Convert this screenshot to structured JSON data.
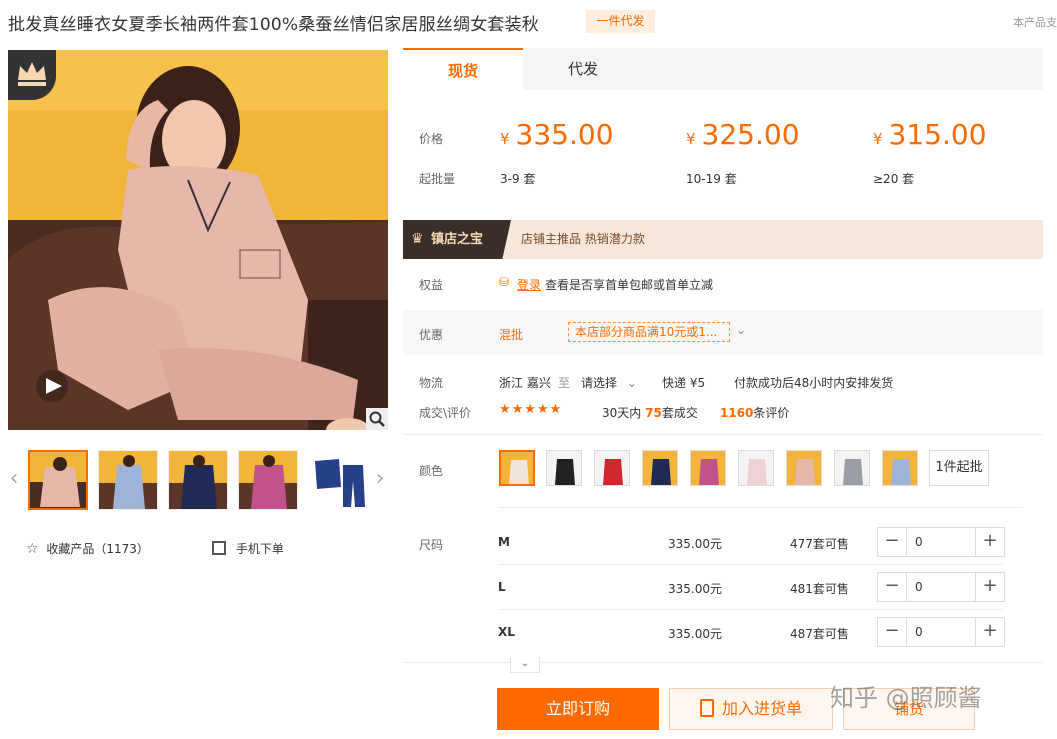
{
  "header": {
    "title": "批发真丝睡衣女夏季长袖两件套100%桑蚕丝情侣家居服丝绸女套装秋",
    "tag": "一件代发",
    "corner_note": "本产品支"
  },
  "gallery": {
    "thumb_count": 6,
    "actions": {
      "favorite_label": "收藏产品（1173）",
      "mobile_label": "手机下单"
    }
  },
  "tabs": [
    {
      "label": "现货",
      "active": true
    },
    {
      "label": "代发",
      "active": false
    }
  ],
  "pricing": {
    "price_label": "价格",
    "moq_label": "起批量",
    "currency": "¥",
    "tiers": [
      {
        "price": "335.00",
        "qty": "3-9",
        "unit": "套"
      },
      {
        "price": "325.00",
        "qty": "10-19",
        "unit": "套"
      },
      {
        "price": "315.00",
        "qty": "≥20",
        "unit": "套"
      }
    ]
  },
  "shop_banner": {
    "tag": "镇店之宝",
    "text": "店铺主推品   热销潜力款"
  },
  "rights": {
    "label": "权益",
    "login": "登录",
    "text": "查看是否享首单包邮或首单立减"
  },
  "promo": {
    "label": "优惠",
    "type": "混批",
    "text": "本店部分商品满10元或1..."
  },
  "shipping": {
    "label": "物流",
    "from": "浙江 嘉兴",
    "to_word": "至",
    "to_select": "请选择",
    "method": "快递 ¥5",
    "note": "付款成功后48小时内安排发货"
  },
  "deals": {
    "label": "成交\\评价",
    "stars": "★★★★★",
    "days_pre": "30天内",
    "count": "75",
    "days_post": "套成交",
    "reviews": "1160",
    "reviews_suffix": "条评价"
  },
  "colors": {
    "label": "颜色",
    "swatch_count": 9,
    "moq_button": "1件起批"
  },
  "sizes": {
    "label": "尺码",
    "rows": [
      {
        "size": "M",
        "price": "335.00元",
        "stock": "477套可售",
        "qty": "0"
      },
      {
        "size": "L",
        "price": "335.00元",
        "stock": "481套可售",
        "qty": "0"
      },
      {
        "size": "XL",
        "price": "335.00元",
        "stock": "487套可售",
        "qty": "0"
      }
    ]
  },
  "buttons": {
    "buy": "立即订购",
    "cart": "加入进货单",
    "distribute": "铺货"
  },
  "watermark": "知乎 @照顾酱",
  "colors_theme": {
    "accent": "#ff6a00",
    "banner_bg": "#f6e7da",
    "banner_dark": "#3a2e29"
  }
}
